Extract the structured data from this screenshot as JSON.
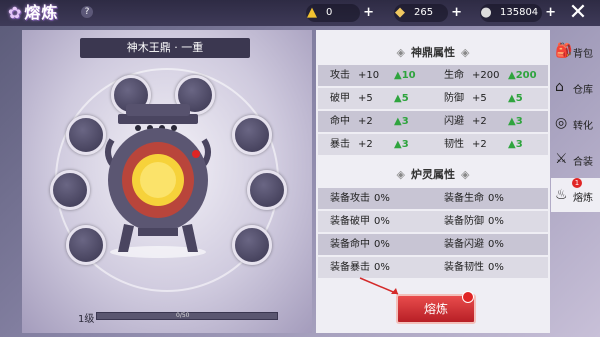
{
  "header": {
    "title": "熔炼",
    "help": "?",
    "currencies": [
      {
        "icon": "gold-ingot-icon",
        "value": "0"
      },
      {
        "icon": "silver-ingot-icon",
        "value": "265"
      },
      {
        "icon": "coin-icon",
        "value": "135804"
      }
    ],
    "close": "✕"
  },
  "cauldron": {
    "name": "神木王鼎 · 一重",
    "level_label": "1级",
    "progress_text": "0/50",
    "progress": 0
  },
  "stats": {
    "section_title": "神鼎属性",
    "rows": [
      {
        "left_label": "攻击",
        "left_value": "+10",
        "left_bonus": "10",
        "right_label": "生命",
        "right_value": "+200",
        "right_bonus": "200"
      },
      {
        "left_label": "破甲",
        "left_value": "+5",
        "left_bonus": "5",
        "right_label": "防御",
        "right_value": "+5",
        "right_bonus": "5"
      },
      {
        "left_label": "命中",
        "left_value": "+2",
        "left_bonus": "3",
        "right_label": "闪避",
        "right_value": "+2",
        "right_bonus": "3"
      },
      {
        "left_label": "暴击",
        "left_value": "+2",
        "left_bonus": "3",
        "right_label": "韧性",
        "right_value": "+2",
        "right_bonus": "3"
      }
    ]
  },
  "spirit": {
    "section_title": "炉灵属性",
    "rows": [
      {
        "left_label": "装备攻击",
        "left_value": "0%",
        "right_label": "装备生命",
        "right_value": "0%"
      },
      {
        "left_label": "装备破甲",
        "left_value": "0%",
        "right_label": "装备防御",
        "right_value": "0%"
      },
      {
        "left_label": "装备命中",
        "left_value": "0%",
        "right_label": "装备闪避",
        "right_value": "0%"
      },
      {
        "left_label": "装备暴击",
        "left_value": "0%",
        "right_label": "装备韧性",
        "right_value": "0%"
      }
    ]
  },
  "smelt_button": "熔炼",
  "tabs": [
    {
      "label": "背包",
      "icon": "backpack-icon"
    },
    {
      "label": "仓库",
      "icon": "warehouse-icon"
    },
    {
      "label": "转化",
      "icon": "convert-icon"
    },
    {
      "label": "合装",
      "icon": "combine-icon"
    },
    {
      "label": "熔炼",
      "icon": "smelt-icon",
      "badge": "1"
    }
  ],
  "colors": {
    "accent": "#c8262b",
    "bonus": "#2fa43e",
    "topbar": "#2e2b44"
  }
}
